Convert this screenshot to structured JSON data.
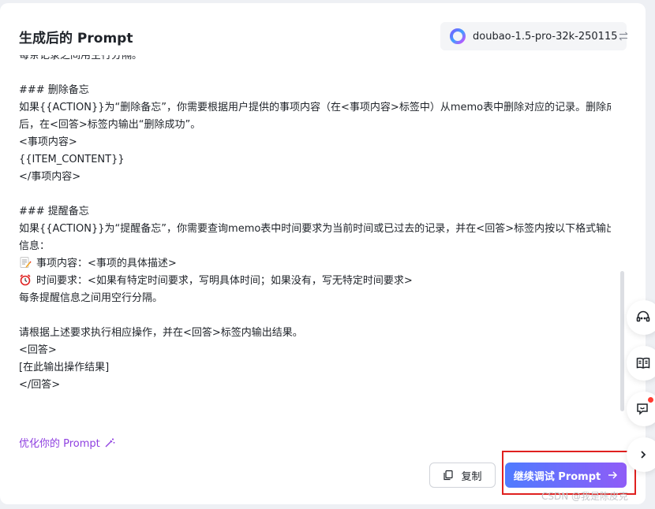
{
  "header": {
    "title": "生成后的 Prompt",
    "model_name": "doubao-1.5-pro-32k-250115"
  },
  "content": {
    "lines": [
      "每条记录之间用空行分隔。",
      "",
      "### 删除备忘",
      "如果{{ACTION}}为“删除备忘”，你需要根据用户提供的事项内容（在<事项内容>标签中）从memo表中删除对应的记录。删除成功",
      "后，在<回答>标签内输出“删除成功”。",
      "<事项内容>",
      "{{ITEM_CONTENT}}",
      "</事项内容>",
      "",
      "### 提醒备忘",
      "如果{{ACTION}}为“提醒备忘”，你需要查询memo表中时间要求为当前时间或已过去的记录，并在<回答>标签内按以下格式输出提醒",
      "信息：",
      "事项内容：<事项的具体描述>",
      "时间要求：<如果有特定时间要求，写明具体时间；如果没有，写无特定时间要求>",
      "每条提醒信息之间用空行分隔。",
      "",
      "请根据上述要求执行相应操作，并在<回答>标签内输出结果。",
      "<回答>",
      "[在此输出操作结果]",
      "</回答>"
    ],
    "line_icons": {
      "12": "memo-emoji-icon",
      "13": "alarm-clock-emoji-icon"
    }
  },
  "footer": {
    "optimize_label": "优化你的 Prompt",
    "copy_label": "复制",
    "continue_label": "继续调试 Prompt"
  },
  "sidebar": {
    "buttons": [
      "support-icon",
      "book-icon",
      "feedback-icon",
      "chevron-right-icon"
    ]
  },
  "watermark": "CSDN @我是陈皮克",
  "colors": {
    "accent_purple": "#8e3fe0",
    "button_gradient_start": "#4f7bff",
    "button_gradient_end": "#8f5cf7",
    "highlight_red": "#e0201f",
    "notification_red": "#ff3b30"
  }
}
